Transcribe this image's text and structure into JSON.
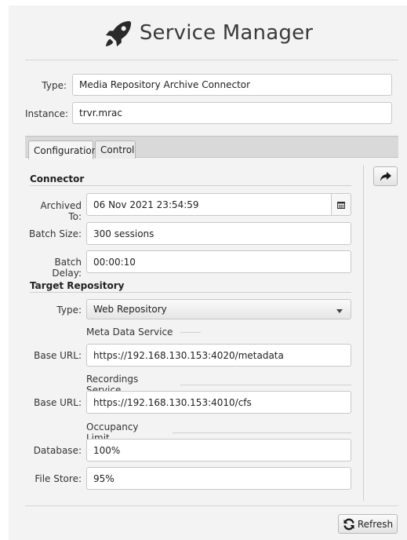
{
  "app": {
    "title": "Service Manager",
    "logo_icon": "rocket-icon"
  },
  "service": {
    "type_label": "Type:",
    "type_value": "Media Repository Archive Connector",
    "instance_label": "Instance:",
    "instance_value": "trvr.mrac"
  },
  "tabs": [
    {
      "label": "Configuration",
      "active": true
    },
    {
      "label": "Control",
      "active": false
    }
  ],
  "connector": {
    "heading": "Connector",
    "archived_to_label": "Archived To:",
    "archived_to_value": "06 Nov 2021 23:54:59",
    "batch_size_label": "Batch Size:",
    "batch_size_value": "300 sessions",
    "batch_delay_label": "Batch Delay:",
    "batch_delay_value": "00:00:10"
  },
  "target": {
    "heading": "Target Repository",
    "type_label": "Type:",
    "type_value": "Web Repository",
    "meta_group": "Meta Data Service",
    "meta_url_label": "Base URL:",
    "meta_url_value": "https://192.168.130.153:4020/metadata",
    "rec_group": "Recordings Service",
    "rec_url_label": "Base URL:",
    "rec_url_value": "https://192.168.130.153:4010/cfs",
    "occ_group": "Occupancy Limit",
    "database_label": "Database:",
    "database_value": "100%",
    "filestore_label": "File Store:",
    "filestore_value": "95%"
  },
  "footer": {
    "refresh_label": "Refresh",
    "refresh_icon": "refresh-icon"
  },
  "side": {
    "share_icon": "share-arrow-icon"
  }
}
